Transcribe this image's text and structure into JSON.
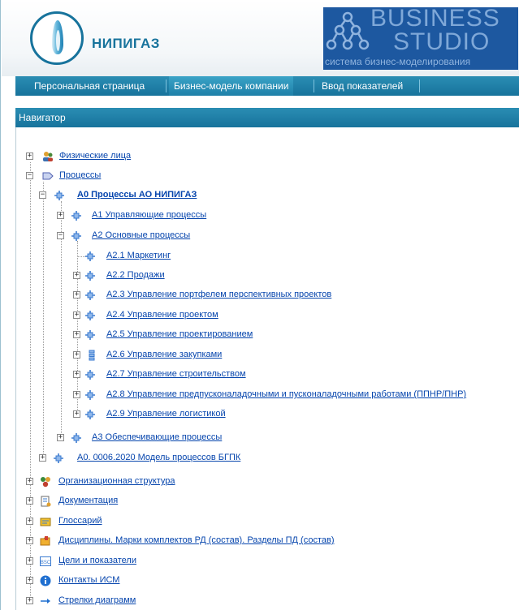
{
  "brand": {
    "company": "НИПИГАЗ"
  },
  "bs_logo": {
    "line1": "BUSINESS",
    "line2": "STUDIO",
    "subtitle": "система бизнес-моделирования"
  },
  "tabs": [
    {
      "label": "Персональная страница",
      "active": false
    },
    {
      "label": "Бизнес-модель компании",
      "active": true
    },
    {
      "label": "Ввод показателей",
      "active": false
    }
  ],
  "navigator": {
    "title": "Навигатор",
    "items": [
      {
        "label": "Физические лица",
        "icon": "people-icon",
        "expander": "+"
      },
      {
        "label": "Процессы",
        "icon": "process-folder-icon",
        "expander": "−"
      },
      {
        "label": "А0 Процессы АО НИПИГАЗ",
        "icon": "process-icon",
        "expander": "−"
      },
      {
        "label": "А1 Управляющие процессы",
        "icon": "process-icon",
        "expander": "+"
      },
      {
        "label": "А2 Основные процессы",
        "icon": "process-icon",
        "expander": "−"
      },
      {
        "label": "А2.1 Маркетинг",
        "icon": "process-icon",
        "expander": ""
      },
      {
        "label": "А2.2 Продажи",
        "icon": "process-icon",
        "expander": "+"
      },
      {
        "label": "А2.3 Управление портфелем перспективных проектов",
        "icon": "process-icon",
        "expander": "+"
      },
      {
        "label": "А2.4 Управление проектом",
        "icon": "process-icon",
        "expander": "+"
      },
      {
        "label": "А2.5 Управление проектированием",
        "icon": "process-icon",
        "expander": "+"
      },
      {
        "label": "А2.6 Управление закупками",
        "icon": "process-list-icon",
        "expander": "+"
      },
      {
        "label": "А2.7 Управление строительством",
        "icon": "process-icon",
        "expander": "+"
      },
      {
        "label": "А2.8 Управление предпусконаладочными и пусконаладочными работами (ППНР/ПНР)",
        "icon": "process-icon",
        "expander": "+"
      },
      {
        "label": "А2.9 Управление логистикой",
        "icon": "process-icon",
        "expander": "+"
      },
      {
        "label": "А3 Обеспечивающие процессы",
        "icon": "process-icon",
        "expander": "+"
      },
      {
        "label": "А0. 0006.2020 Модель процессов БГПК",
        "icon": "process-icon",
        "expander": "+"
      },
      {
        "label": "Организационная структура",
        "icon": "org-structure-icon",
        "expander": "+"
      },
      {
        "label": "Документация",
        "icon": "document-icon",
        "expander": "+"
      },
      {
        "label": "Глоссарий",
        "icon": "glossary-icon",
        "expander": "+"
      },
      {
        "label": "Дисциплины. Марки комплектов РД (состав). Разделы ПД (состав)",
        "icon": "folder-icon",
        "expander": "+"
      },
      {
        "label": "Цели и показатели",
        "icon": "bsc-icon",
        "expander": "+"
      },
      {
        "label": "Контакты ИСМ",
        "icon": "info-icon",
        "expander": "+"
      },
      {
        "label": "Стрелки диаграмм",
        "icon": "arrow-icon",
        "expander": "+"
      }
    ]
  }
}
